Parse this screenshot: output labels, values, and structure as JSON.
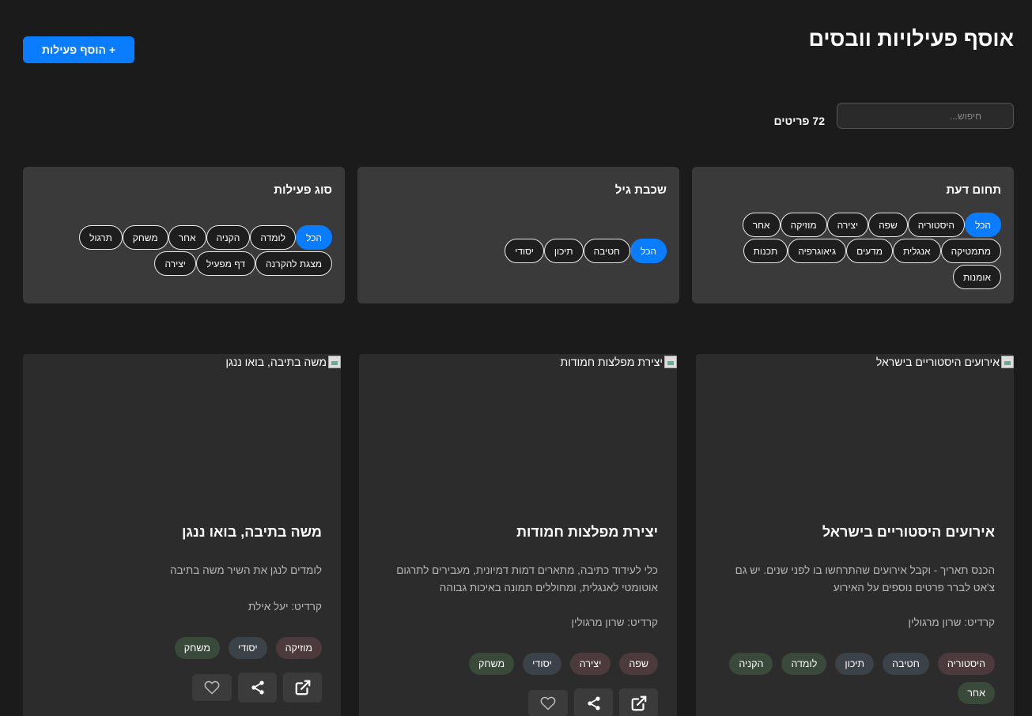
{
  "header": {
    "title": "אוסף פעילויות וובסים",
    "add_button": "+ הוסף פעילות"
  },
  "search": {
    "placeholder": "חיפוש...",
    "value": ""
  },
  "count": "72 פריטים",
  "colors": {
    "accent": "#0a7cff",
    "background": "#1b1b1b",
    "panel": "#3a3a3a",
    "card": "#2c2c2c",
    "tag_red": "#4d3a3d",
    "tag_green": "#3a4a3a",
    "tag_slate": "#3b4349"
  },
  "filters": {
    "subject": {
      "title": "תחום דעת",
      "chips": [
        "הכל",
        "היסטוריה",
        "שפה",
        "יצירה",
        "מוזיקה",
        "אחר",
        "מתמטיקה",
        "אנגלית",
        "מדעים",
        "גיאוגרפיה",
        "תכנות",
        "אומנות"
      ],
      "selected": "הכל"
    },
    "age": {
      "title": "שכבת גיל",
      "chips": [
        "הכל",
        "חטיבה",
        "תיכון",
        "יסודי"
      ],
      "selected": "הכל"
    },
    "type": {
      "title": "סוג פעילות",
      "chips": [
        "הכל",
        "לומדה",
        "הקניה",
        "אחר",
        "משחק",
        "תרגול",
        "מצגת להקרנה",
        "דף מפעיל",
        "יצירה"
      ],
      "selected": "הכל"
    }
  },
  "cards": [
    {
      "image_alt": "אירועים היסטוריים בישראל",
      "title": "אירועים היסטוריים בישראל",
      "description": "הכנס תאריך - וקבל אירועים שהתרחשו בו לפני שנים. יש גם צ'אט לברר פרטים נוספים על האירוע",
      "credit": "קרדיט: שרון מרגולין",
      "tags": [
        "היסטוריה",
        "חטיבה",
        "תיכון",
        "לומדה",
        "הקניה",
        "אחר"
      ]
    },
    {
      "image_alt": "יצירת מפלצות חמודות",
      "title": "יצירת מפלצות חמודות",
      "description": "כלי לעידוד כתיבה, מתארים דמות דמיונית, מעבירים לתרגום אוטומטי לאנגלית, ומחוללים תמונה באיכות גבוהה",
      "credit": "קרדיט: שרון מרגולין",
      "tags": [
        "שפה",
        "יצירה",
        "יסודי",
        "משחק"
      ]
    },
    {
      "image_alt": "משה בתיבה, בואו ננגן",
      "title": "משה בתיבה, בואו ננגן",
      "description": "לומדים לנגן את השיר משה בתיבה",
      "credit": "קרדיט: יעל אילת",
      "tags": [
        "מוזיקה",
        "יסודי",
        "משחק"
      ]
    }
  ],
  "card_actions": [
    "open-external-icon",
    "share-icon",
    "heart-icon"
  ]
}
